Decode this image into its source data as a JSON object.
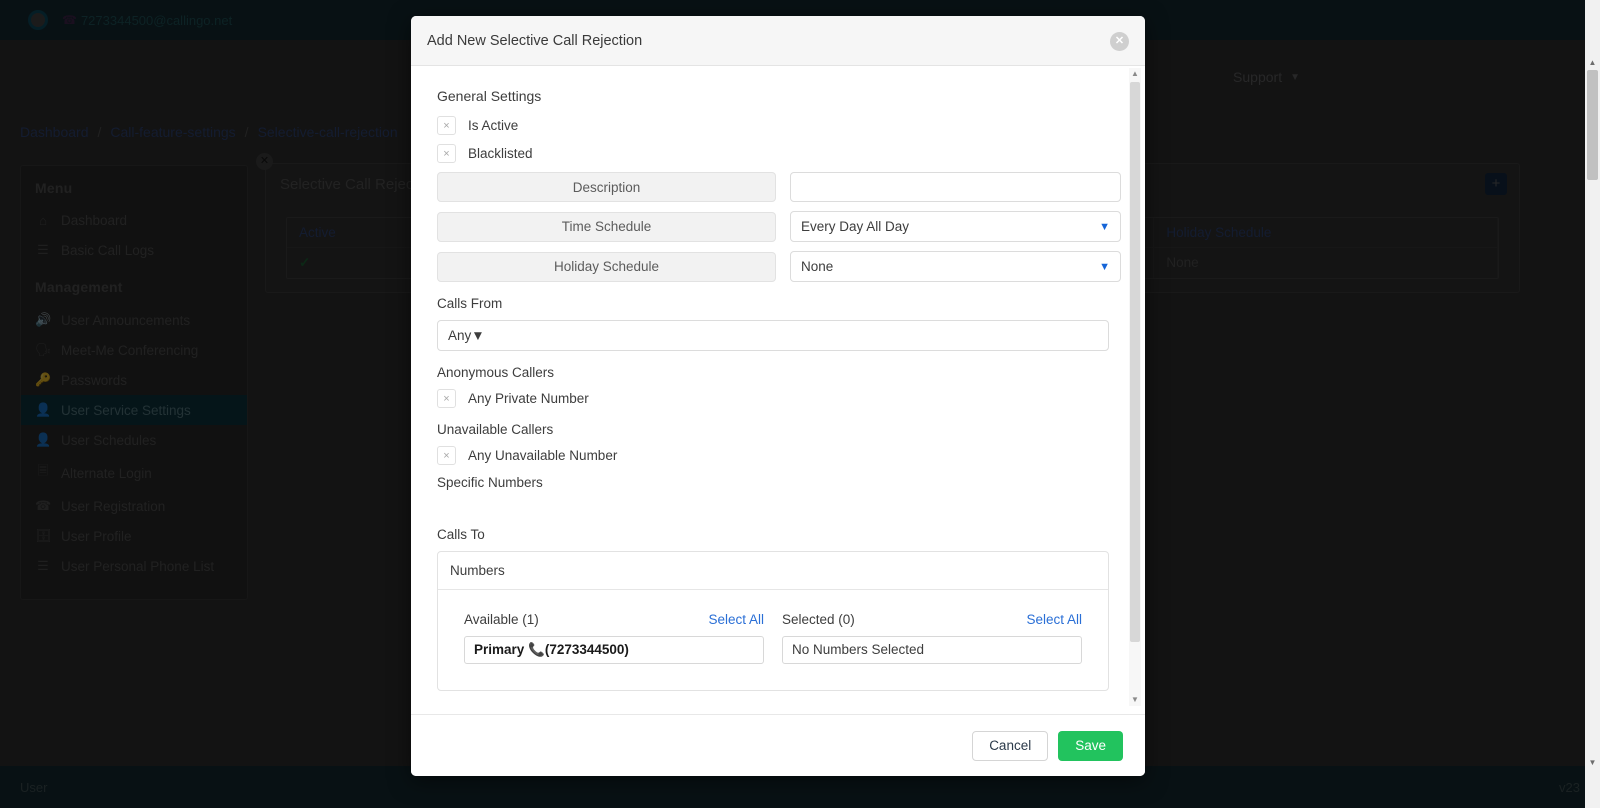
{
  "topbar": {
    "user_account": "7273344500@callingo.net",
    "phone_icon": "phone-icon"
  },
  "navbar": {
    "support_label": "Support",
    "caret_icon": "chevron-down-icon"
  },
  "breadcrumb": {
    "items": [
      "Dashboard",
      "Call-feature-settings",
      "Selective-call-rejection"
    ],
    "separator": "/"
  },
  "sidebar": {
    "groups": [
      {
        "title": "Menu",
        "items": [
          {
            "label": "Dashboard",
            "icon": "home-icon",
            "active": false
          },
          {
            "label": "Basic Call Logs",
            "icon": "list-icon",
            "active": false
          }
        ]
      },
      {
        "title": "Management",
        "items": [
          {
            "label": "User Announcements",
            "icon": "speaker-icon",
            "active": false
          },
          {
            "label": "Meet-Me Conferencing",
            "icon": "conference-icon",
            "active": false
          },
          {
            "label": "Passwords",
            "icon": "key-icon",
            "active": false
          },
          {
            "label": "User Service Settings",
            "icon": "user-gear-icon",
            "active": true
          },
          {
            "label": "User Schedules",
            "icon": "user-clock-icon",
            "active": false
          },
          {
            "label": "Alternate Login",
            "icon": "id-badge-icon",
            "active": false
          },
          {
            "label": "User Registration",
            "icon": "phone-icon",
            "active": false
          },
          {
            "label": "User Profile",
            "icon": "id-card-icon",
            "active": false
          },
          {
            "label": "User Personal Phone List",
            "icon": "list-icon",
            "active": false
          }
        ]
      }
    ],
    "close_icon": "close-circle-icon"
  },
  "content": {
    "title": "Selective Call Rejection",
    "add_button_icon": "plus-icon",
    "table": {
      "headers": [
        "Active",
        "Holiday Schedule"
      ],
      "rows": [
        {
          "active": "✓",
          "holiday_schedule": "None"
        }
      ]
    }
  },
  "modal": {
    "title": "Add New Selective Call Rejection",
    "close_icon": "close-icon",
    "general_settings_label": "General Settings",
    "checkboxes": [
      {
        "label": "Is Active",
        "mark": "×",
        "checked": false
      },
      {
        "label": "Blacklisted",
        "mark": "×",
        "checked": false
      }
    ],
    "fields": [
      {
        "name": "Description",
        "type": "text",
        "value": "",
        "placeholder": ""
      },
      {
        "name": "Time Schedule",
        "type": "select",
        "value": "Every Day All Day"
      },
      {
        "name": "Holiday Schedule",
        "type": "select",
        "value": "None"
      }
    ],
    "calls_from": {
      "label": "Calls From",
      "value": "Any",
      "caret_icon": "chevron-down-icon"
    },
    "anonymous_callers": {
      "label": "Anonymous Callers",
      "checkbox": {
        "label": "Any Private Number",
        "mark": "×",
        "checked": false
      }
    },
    "unavailable_callers": {
      "label": "Unavailable Callers",
      "checkbox": {
        "label": "Any Unavailable Number",
        "mark": "×",
        "checked": false
      }
    },
    "specific_numbers_label": "Specific Numbers",
    "calls_to": {
      "label": "Calls To",
      "card_title": "Numbers",
      "available": {
        "heading": "Available (1)",
        "select_all": "Select All",
        "items": [
          {
            "name": "Primary ",
            "icon": "📞",
            "number": "(7273344500)"
          }
        ]
      },
      "selected": {
        "heading": "Selected (0)",
        "select_all": "Select All",
        "empty_text": "No Numbers Selected"
      }
    },
    "footer": {
      "cancel_label": "Cancel",
      "save_label": "Save"
    }
  },
  "footer": {
    "left_label": "User",
    "right_label": "v23"
  },
  "colors": {
    "accent_blue": "#2a6fd6",
    "save_green": "#22c35e",
    "topbar_dark": "#12272d",
    "sidebar_active": "#0d2f38"
  }
}
